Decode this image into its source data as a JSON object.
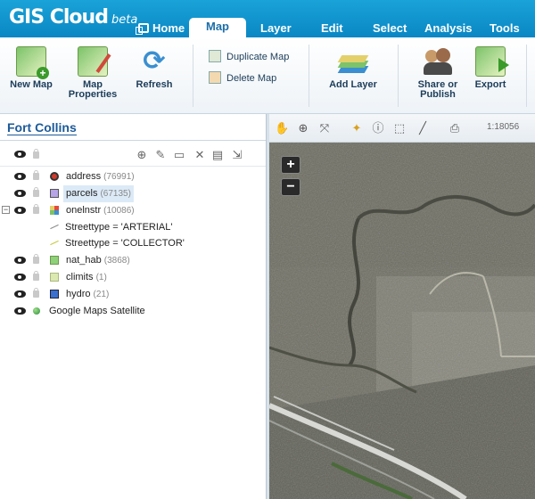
{
  "app": {
    "logo": "GIS Cloud",
    "beta": "beta"
  },
  "menu": [
    {
      "label": "Home"
    },
    {
      "label": "Map",
      "active": true
    },
    {
      "label": "Layer"
    },
    {
      "label": "Edit"
    },
    {
      "label": "Select"
    },
    {
      "label": "Analysis"
    },
    {
      "label": "Tools"
    }
  ],
  "ribbon": {
    "new_map": {
      "line1": "New Map",
      "line2": ""
    },
    "map_properties": {
      "line1": "Map",
      "line2": "Properties"
    },
    "refresh": {
      "line1": "Refresh",
      "line2": ""
    },
    "duplicate_map": "Duplicate Map",
    "delete_map": "Delete Map",
    "add_layer": "Add Layer",
    "share": {
      "line1": "Share or",
      "line2": "Publish"
    },
    "export": "Export"
  },
  "project": {
    "title": "Fort Collins"
  },
  "layers": [
    {
      "name": "address",
      "count": "(76991)",
      "symbol": "red-dot"
    },
    {
      "name": "parcels",
      "count": "(67135)",
      "symbol": "purple-square",
      "selected": true
    },
    {
      "name": "onelnstr",
      "count": "(10086)",
      "symbol": "multi-grid",
      "expanded": true
    },
    {
      "name": "nat_hab",
      "count": "(3868)",
      "symbol": "green-square"
    },
    {
      "name": "climits",
      "count": "(1)",
      "symbol": "lightgreen-square"
    },
    {
      "name": "hydro",
      "count": "(21)",
      "symbol": "blue-square"
    },
    {
      "name": "Google Maps Satellite",
      "count": "",
      "symbol": "globe"
    }
  ],
  "sublayers": [
    {
      "label": "Streettype = 'ARTERIAL'",
      "color": "#888888"
    },
    {
      "label": "Streettype = 'COLLECTOR'",
      "color": "#c8c840"
    }
  ],
  "map": {
    "scale": "1:18056",
    "zoom_in": "+",
    "zoom_out": "−"
  },
  "colors": {
    "header": "#0a87c4",
    "accent": "#1c5a99"
  }
}
